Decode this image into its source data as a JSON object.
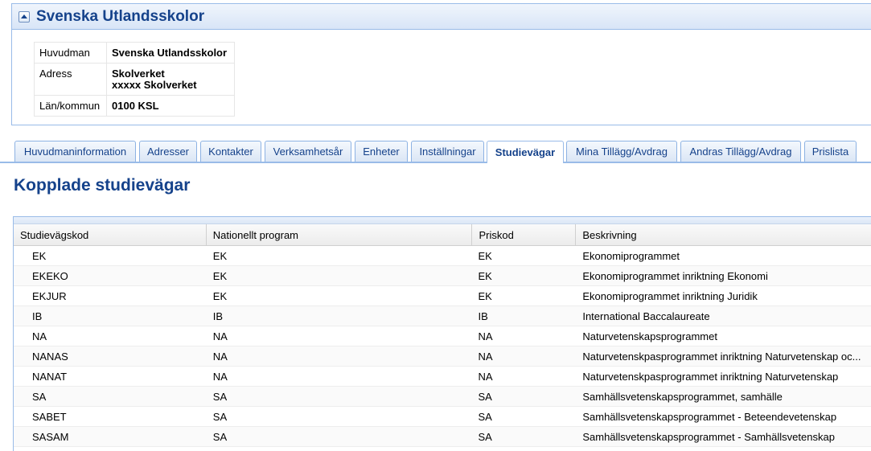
{
  "panel": {
    "title": "Svenska Utlandsskolor",
    "info": [
      {
        "label": "Huvudman",
        "value": "Svenska Utlandsskolor"
      },
      {
        "label": "Adress",
        "value_line1": "Skolverket",
        "value_line2": "xxxxx Skolverket"
      },
      {
        "label": "Län/kommun",
        "value": "0100 KSL"
      }
    ]
  },
  "tabs": [
    {
      "label": "Huvudmaninformation"
    },
    {
      "label": "Adresser"
    },
    {
      "label": "Kontakter"
    },
    {
      "label": "Verksamhetsår"
    },
    {
      "label": "Enheter"
    },
    {
      "label": "Inställningar"
    },
    {
      "label": "Studievägar",
      "active": true
    },
    {
      "label": "Mina Tillägg/Avdrag"
    },
    {
      "label": "Andras Tillägg/Avdrag"
    },
    {
      "label": "Prislista"
    }
  ],
  "section_title": "Kopplade studievägar",
  "grid": {
    "columns": [
      "Studievägskod",
      "Nationellt program",
      "Priskod",
      "Beskrivning"
    ],
    "rows": [
      [
        "EK",
        "EK",
        "EK",
        "Ekonomiprogrammet"
      ],
      [
        "EKEKO",
        "EK",
        "EK",
        "Ekonomiprogrammet inriktning Ekonomi"
      ],
      [
        "EKJUR",
        "EK",
        "EK",
        "Ekonomiprogrammet inriktning Juridik"
      ],
      [
        "IB",
        "IB",
        "IB",
        "International Baccalaureate"
      ],
      [
        "NA",
        "NA",
        "NA",
        "Naturvetenskapsprogrammet"
      ],
      [
        "NANAS",
        "NA",
        "NA",
        "Naturvetenskpasprogrammet inriktning Naturvetenskap oc..."
      ],
      [
        "NANAT",
        "NA",
        "NA",
        "Naturvetenskpasprogrammet inriktning Naturvetenskap"
      ],
      [
        "SA",
        "SA",
        "SA",
        "Samhällsvetenskapsprogrammet, samhälle"
      ],
      [
        "SABET",
        "SA",
        "SA",
        "Samhällsvetenskapsprogrammet - Beteendevetenskap"
      ],
      [
        "SASAM",
        "SA",
        "SA",
        "Samhällsvetenskapsprogrammet - Samhällsvetenskap"
      ]
    ]
  }
}
